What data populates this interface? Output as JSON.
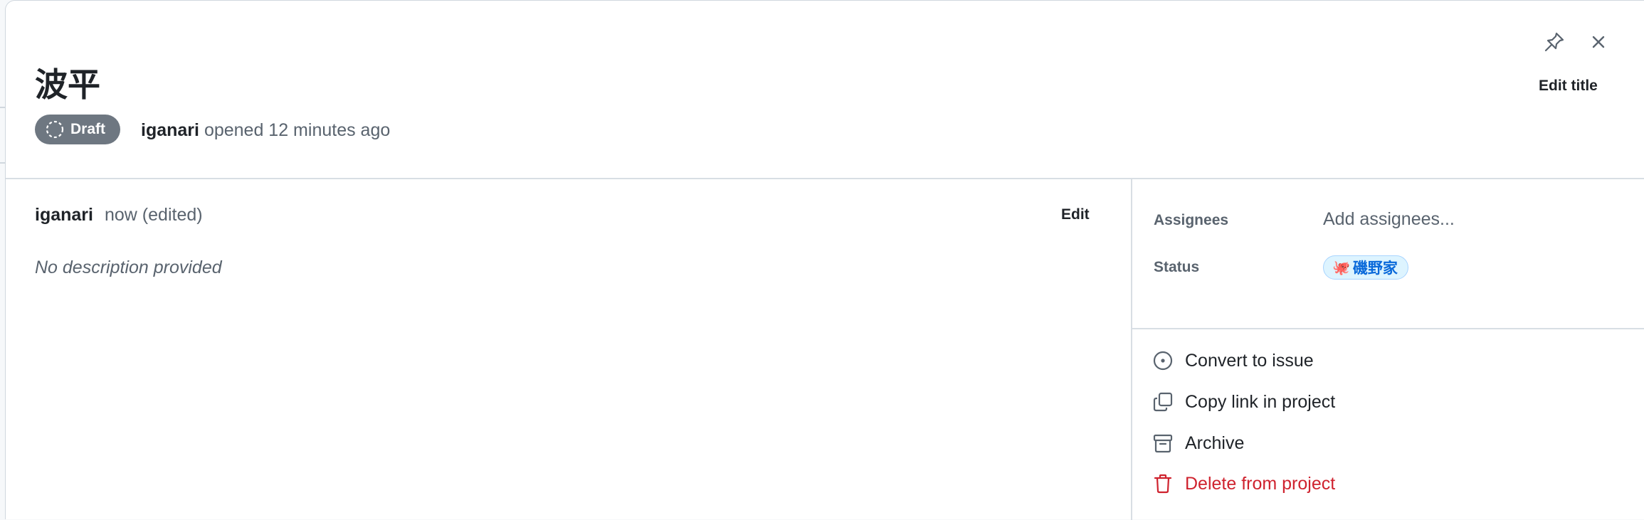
{
  "header": {
    "title": "波平",
    "badge_label": "Draft",
    "author": "iganari",
    "opened_text": "opened 12 minutes ago",
    "edit_title_label": "Edit title"
  },
  "comment": {
    "author": "iganari",
    "time": "now (edited)",
    "edit_label": "Edit",
    "body": "No description provided"
  },
  "sidebar": {
    "assignees_label": "Assignees",
    "assignees_value": "Add assignees...",
    "status_label": "Status",
    "status_value": "磯野家",
    "status_emoji": "🐙"
  },
  "actions": {
    "convert": "Convert to issue",
    "copy_link": "Copy link in project",
    "archive": "Archive",
    "delete": "Delete from project"
  },
  "colors": {
    "draft_badge": "#6e7781",
    "status_chip_bg": "#ddf4ff",
    "status_chip_text": "#0969da",
    "danger": "#cf222e"
  },
  "icons": [
    "pin-icon",
    "close-icon",
    "draft-circle-icon",
    "issue-opened-icon",
    "copy-icon",
    "archive-icon",
    "trash-icon"
  ]
}
